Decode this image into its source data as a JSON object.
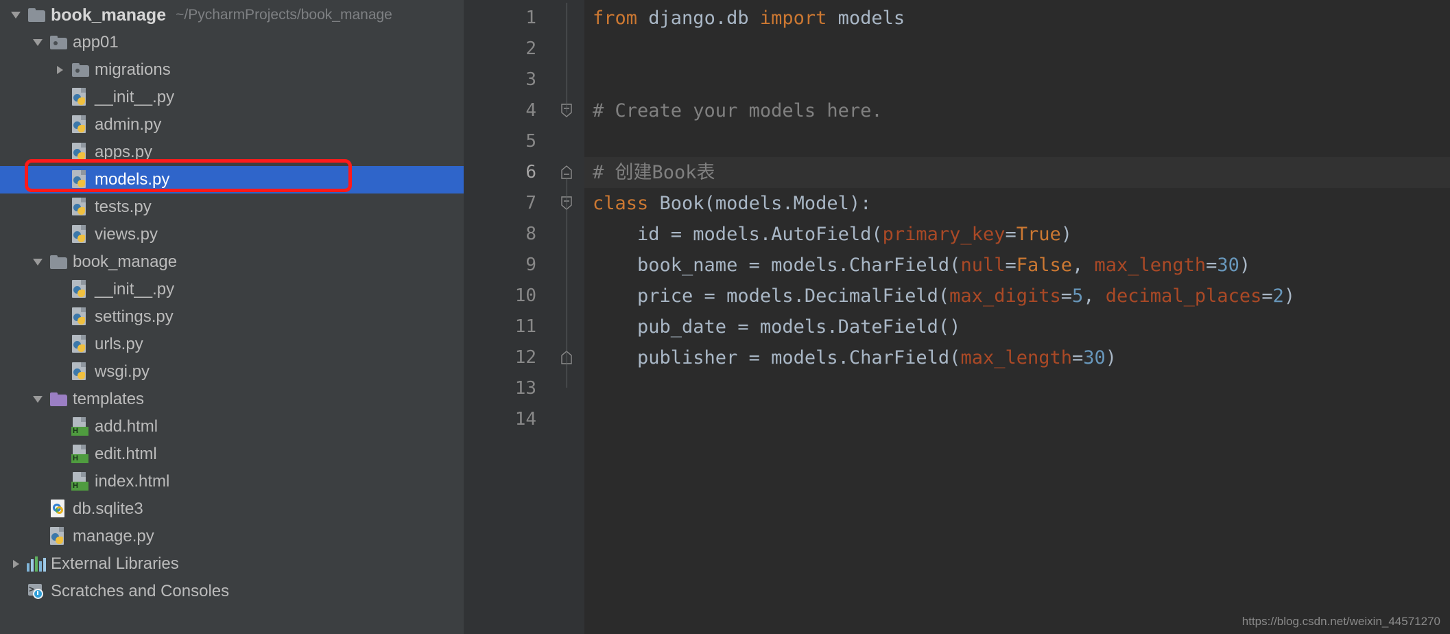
{
  "project": {
    "root_label": "book_manage",
    "root_path": "~/PycharmProjects/book_manage",
    "tree": [
      {
        "label": "book_manage",
        "path": "~/PycharmProjects/book_manage",
        "indent": 0,
        "arrow": "open",
        "icon": "folder",
        "bold": true,
        "selected": false
      },
      {
        "label": "app01",
        "path": "",
        "indent": 1,
        "arrow": "open",
        "icon": "folder-module",
        "bold": false,
        "selected": false
      },
      {
        "label": "migrations",
        "path": "",
        "indent": 2,
        "arrow": "closed",
        "icon": "folder-module",
        "bold": false,
        "selected": false
      },
      {
        "label": "__init__.py",
        "path": "",
        "indent": 2,
        "arrow": "none",
        "icon": "python-file",
        "bold": false,
        "selected": false
      },
      {
        "label": "admin.py",
        "path": "",
        "indent": 2,
        "arrow": "none",
        "icon": "python-file",
        "bold": false,
        "selected": false
      },
      {
        "label": "apps.py",
        "path": "",
        "indent": 2,
        "arrow": "none",
        "icon": "python-file",
        "bold": false,
        "selected": false
      },
      {
        "label": "models.py",
        "path": "",
        "indent": 2,
        "arrow": "none",
        "icon": "python-file",
        "bold": false,
        "selected": true
      },
      {
        "label": "tests.py",
        "path": "",
        "indent": 2,
        "arrow": "none",
        "icon": "python-file",
        "bold": false,
        "selected": false
      },
      {
        "label": "views.py",
        "path": "",
        "indent": 2,
        "arrow": "none",
        "icon": "python-file",
        "bold": false,
        "selected": false
      },
      {
        "label": "book_manage",
        "path": "",
        "indent": 1,
        "arrow": "open",
        "icon": "folder",
        "bold": false,
        "selected": false
      },
      {
        "label": "__init__.py",
        "path": "",
        "indent": 2,
        "arrow": "none",
        "icon": "python-file",
        "bold": false,
        "selected": false
      },
      {
        "label": "settings.py",
        "path": "",
        "indent": 2,
        "arrow": "none",
        "icon": "python-file",
        "bold": false,
        "selected": false
      },
      {
        "label": "urls.py",
        "path": "",
        "indent": 2,
        "arrow": "none",
        "icon": "python-file",
        "bold": false,
        "selected": false
      },
      {
        "label": "wsgi.py",
        "path": "",
        "indent": 2,
        "arrow": "none",
        "icon": "python-file",
        "bold": false,
        "selected": false
      },
      {
        "label": "templates",
        "path": "",
        "indent": 1,
        "arrow": "open",
        "icon": "folder-templates",
        "bold": false,
        "selected": false
      },
      {
        "label": "add.html",
        "path": "",
        "indent": 2,
        "arrow": "none",
        "icon": "html-file",
        "bold": false,
        "selected": false
      },
      {
        "label": "edit.html",
        "path": "",
        "indent": 2,
        "arrow": "none",
        "icon": "html-file",
        "bold": false,
        "selected": false
      },
      {
        "label": "index.html",
        "path": "",
        "indent": 2,
        "arrow": "none",
        "icon": "html-file",
        "bold": false,
        "selected": false
      },
      {
        "label": "db.sqlite3",
        "path": "",
        "indent": 1,
        "arrow": "none",
        "icon": "sqlite-file",
        "bold": false,
        "selected": false
      },
      {
        "label": "manage.py",
        "path": "",
        "indent": 1,
        "arrow": "none",
        "icon": "python-file",
        "bold": false,
        "selected": false
      },
      {
        "label": "External Libraries",
        "path": "",
        "indent": 0,
        "arrow": "closed",
        "icon": "libraries",
        "bold": false,
        "selected": false
      },
      {
        "label": "Scratches and Consoles",
        "path": "",
        "indent": 0,
        "arrow": "none",
        "icon": "scratches",
        "bold": false,
        "selected": false
      }
    ],
    "annotation": {
      "shape": "rounded-rect",
      "color": "#ff1a1a",
      "target": "models.py"
    }
  },
  "editor": {
    "current_line": 6,
    "gutter_numbers": [
      "1",
      "2",
      "3",
      "4",
      "5",
      "6",
      "7",
      "8",
      "9",
      "10",
      "11",
      "12",
      "13",
      "14"
    ],
    "fold_markers": [
      {
        "line": 4,
        "type": "collapse"
      },
      {
        "line": 6,
        "type": "region-start"
      },
      {
        "line": 7,
        "type": "collapse"
      },
      {
        "line": 12,
        "type": "region-end"
      }
    ],
    "lines": [
      {
        "n": 1,
        "tokens": [
          {
            "t": "from",
            "c": "kw"
          },
          {
            "t": " django.db ",
            "c": "txt"
          },
          {
            "t": "import",
            "c": "kw"
          },
          {
            "t": " models",
            "c": "txt"
          }
        ]
      },
      {
        "n": 2,
        "tokens": []
      },
      {
        "n": 3,
        "tokens": []
      },
      {
        "n": 4,
        "tokens": [
          {
            "t": "# Create your models here.",
            "c": "cmt"
          }
        ]
      },
      {
        "n": 5,
        "tokens": []
      },
      {
        "n": 6,
        "tokens": [
          {
            "t": "# 创建Book表",
            "c": "cmt"
          }
        ]
      },
      {
        "n": 7,
        "tokens": [
          {
            "t": "class",
            "c": "kw"
          },
          {
            "t": " Book(models.Model):",
            "c": "txt"
          }
        ]
      },
      {
        "n": 8,
        "tokens": [
          {
            "t": "    id = models.AutoField(",
            "c": "txt"
          },
          {
            "t": "primary_key",
            "c": "kwarg"
          },
          {
            "t": "=",
            "c": "txt"
          },
          {
            "t": "True",
            "c": "const"
          },
          {
            "t": ")",
            "c": "txt"
          }
        ]
      },
      {
        "n": 9,
        "tokens": [
          {
            "t": "    book_name = models.CharField(",
            "c": "txt"
          },
          {
            "t": "null",
            "c": "kwarg"
          },
          {
            "t": "=",
            "c": "txt"
          },
          {
            "t": "False",
            "c": "const"
          },
          {
            "t": ", ",
            "c": "txt"
          },
          {
            "t": "max_length",
            "c": "kwarg"
          },
          {
            "t": "=",
            "c": "txt"
          },
          {
            "t": "30",
            "c": "num"
          },
          {
            "t": ")",
            "c": "txt"
          }
        ]
      },
      {
        "n": 10,
        "tokens": [
          {
            "t": "    price = models.DecimalField(",
            "c": "txt"
          },
          {
            "t": "max_digits",
            "c": "kwarg"
          },
          {
            "t": "=",
            "c": "txt"
          },
          {
            "t": "5",
            "c": "num"
          },
          {
            "t": ", ",
            "c": "txt"
          },
          {
            "t": "decimal_places",
            "c": "kwarg"
          },
          {
            "t": "=",
            "c": "txt"
          },
          {
            "t": "2",
            "c": "num"
          },
          {
            "t": ")",
            "c": "txt"
          }
        ]
      },
      {
        "n": 11,
        "tokens": [
          {
            "t": "    pub_date = models.DateField()",
            "c": "txt"
          }
        ]
      },
      {
        "n": 12,
        "tokens": [
          {
            "t": "    publisher = models.CharField(",
            "c": "txt"
          },
          {
            "t": "max_length",
            "c": "kwarg"
          },
          {
            "t": "=",
            "c": "txt"
          },
          {
            "t": "30",
            "c": "num"
          },
          {
            "t": ")",
            "c": "txt"
          }
        ]
      },
      {
        "n": 13,
        "tokens": []
      },
      {
        "n": 14,
        "tokens": []
      }
    ]
  },
  "watermark": "https://blog.csdn.net/weixin_44571270",
  "colors": {
    "sidebar_bg": "#3c3f41",
    "editor_bg": "#2b2b2b",
    "gutter_bg": "#313335",
    "selection_blue": "#2f65ca",
    "annotation_red": "#ff1a1a",
    "keyword_orange": "#cc7832",
    "kwarg_red": "#aa4926",
    "number_blue": "#6897bb",
    "comment_gray": "#808080",
    "text_gray": "#a9b7c6"
  }
}
